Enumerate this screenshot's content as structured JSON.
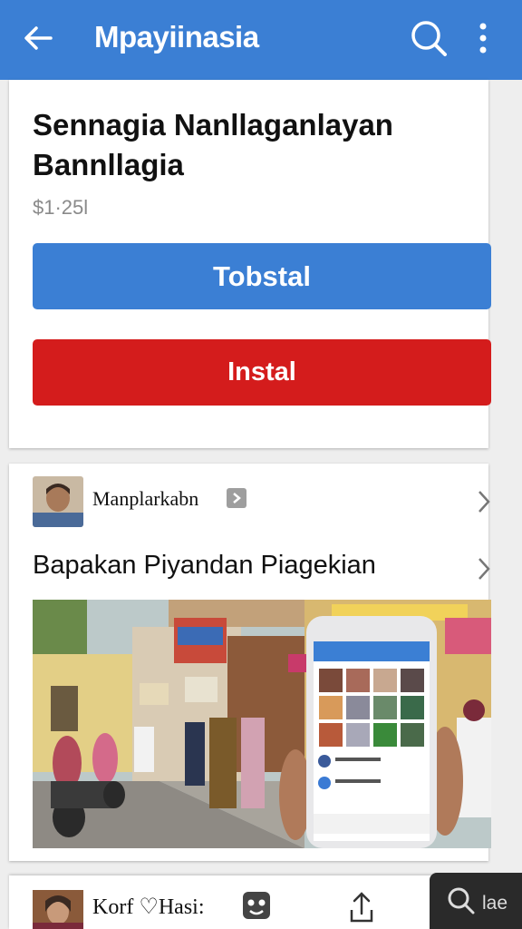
{
  "header": {
    "title": "Mpayiinasia",
    "back_icon": "arrow-left-icon",
    "search_icon": "search-icon",
    "more_icon": "more-vert-icon",
    "color": "#3b7fd4"
  },
  "app": {
    "title": "Sennagia Nanllaganlayan Bannllagia",
    "price": "$1·25l",
    "primary_button": "Tobstal",
    "secondary_button": "Instal",
    "primary_color": "#3b7fd4",
    "secondary_color": "#d41c1c"
  },
  "post": {
    "author": "Manplarkabn",
    "heading": "Bapakan Piyandan Piagekian"
  },
  "bottom": {
    "label": "Korf ♡Hasi:",
    "search_text": "lae"
  }
}
